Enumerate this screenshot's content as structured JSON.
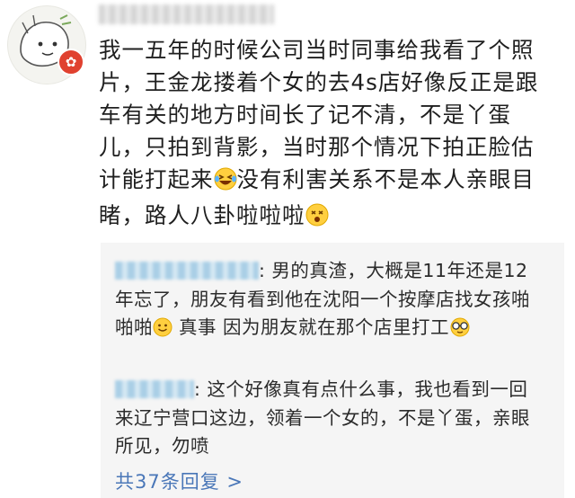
{
  "comment": {
    "text_part1": "我一五年的时候公司当时同事给我看了个照片，王金龙搂着个女的去4s店好像反正是跟车有关的地方时间长了记不清，不是丫蛋儿，只拍到背影，当时那个情况下拍正脸估计能打起来",
    "text_part2": "没有利害关系不是本人亲眼目睹，路人八卦啦啦啦"
  },
  "replies": [
    {
      "part1": ": 男的真渣，大概是11年还是12年忘了，朋友有看到他在沈阳一个按摩店找女孩啪啪啪",
      "part2": " 真事 因为朋友就在那个店里打工"
    },
    {
      "part1": ": 这个好像真有点什么事，我也看到一回来辽宁营口这边，领着一个女的，不是丫蛋，亲眼所见，勿喷"
    }
  ],
  "more_replies": {
    "label": "共37条回复",
    "chevron": ">"
  },
  "colors": {
    "link": "#4a77b8",
    "reply_bg": "#f5f5f5",
    "badge": "#e0412f"
  },
  "icons": [
    "avatar-illustration",
    "red-badge-icon",
    "laughing-tears-emoji",
    "dizzy-face-emoji",
    "smile-emoji",
    "glasses-emoji"
  ]
}
